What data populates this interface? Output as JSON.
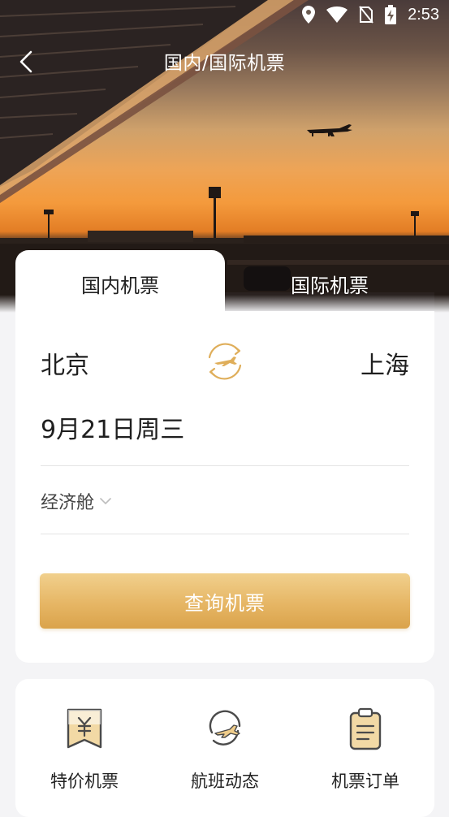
{
  "status_bar": {
    "time": "2:53"
  },
  "header": {
    "title": "国内/国际机票"
  },
  "tabs": [
    {
      "label": "国内机票",
      "active": true
    },
    {
      "label": "国际机票",
      "active": false
    }
  ],
  "booking": {
    "from_city": "北京",
    "to_city": "上海",
    "date": "9月21日周三",
    "cabin_class": "经济舱",
    "search_label": "查询机票"
  },
  "services": [
    {
      "label": "特价机票",
      "icon": "discount-ticket-icon"
    },
    {
      "label": "航班动态",
      "icon": "flight-status-icon"
    },
    {
      "label": "机票订单",
      "icon": "ticket-orders-icon"
    }
  ],
  "colors": {
    "accent": "#dfae5a",
    "accent_dark": "#c99a4a",
    "card_bg": "#ffffff",
    "page_bg": "#f4f4f6"
  }
}
